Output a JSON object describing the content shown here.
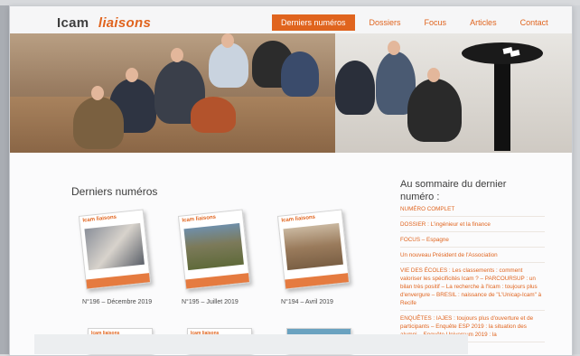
{
  "header": {
    "logo_prefix": "Icam",
    "logo_suffix": "liaisons",
    "nav": [
      {
        "label": "Derniers numéros",
        "active": true
      },
      {
        "label": "Dossiers",
        "active": false
      },
      {
        "label": "Focus",
        "active": false
      },
      {
        "label": "Articles",
        "active": false
      },
      {
        "label": "Contact",
        "active": false
      }
    ]
  },
  "main": {
    "section_title": "Derniers numéros",
    "issues": [
      {
        "label": "N°196 – Décembre 2019"
      },
      {
        "label": "N°195 – Juillet 2019"
      },
      {
        "label": "N°194 – Avril 2019"
      }
    ]
  },
  "sidebar": {
    "title": "Au sommaire du dernier numéro :",
    "items": [
      "NUMÉRO COMPLET",
      "DOSSIER : L'ingénieur et la finance",
      "FOCUS – Espagne",
      "Un nouveau Président de l'Association",
      "VIE DES ÉCOLES : Les classements : comment valoriser les spécificités Icam ? – PARCOURSUP : un bilan très positif – La recherche à l'Icam : toujours plus d'envergure – BRESIL : naissance de \"L'Unicap-Icam\" à Recife",
      "ENQUÊTES : IAJES : toujours plus d'ouverture et de participants – Enquête ESP 2019 : la situation des alumni – Enquête Universum 2019 : la"
    ]
  },
  "colors": {
    "accent": "#e0641e",
    "text": "#3c3c3c"
  }
}
